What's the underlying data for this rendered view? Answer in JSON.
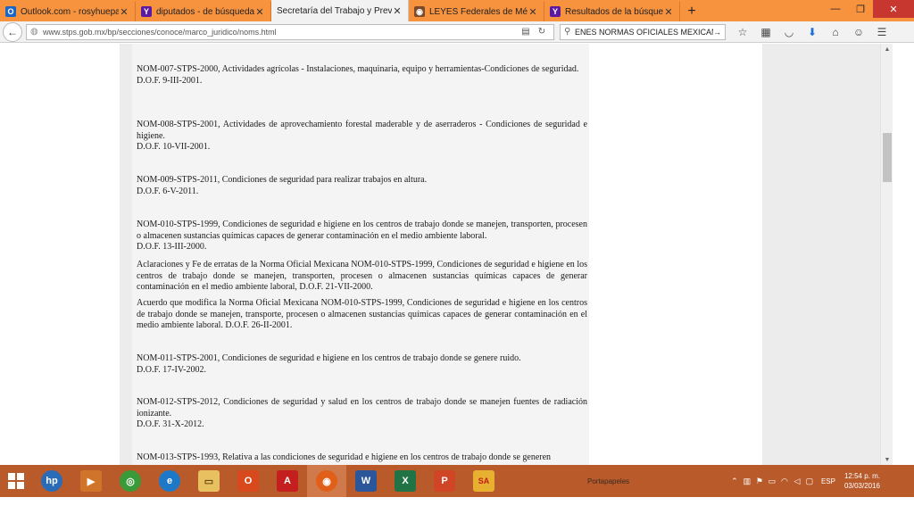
{
  "browser": {
    "tabs": [
      {
        "title": "Outlook.com - rosyhuepa...",
        "icon": "O",
        "icon_color": "#1a66c4",
        "close": "✕"
      },
      {
        "title": "diputados - de búsqueda",
        "icon": "Y",
        "icon_color": "#5b1aa0",
        "close": "✕"
      },
      {
        "title": "Secretaría del Trabajo y Previsi...",
        "icon": "",
        "icon_color": "",
        "close": "✕"
      },
      {
        "title": "LEYES Federales de México",
        "icon": "◉",
        "icon_color": "#7a4a2a",
        "close": "✕"
      },
      {
        "title": "Resultados de la búsqued...",
        "icon": "Y",
        "icon_color": "#5b1aa0",
        "close": "✕"
      }
    ],
    "new_tab": "+",
    "window_controls": {
      "minimize": "—",
      "restore": "❐",
      "close": "✕"
    },
    "url": "www.stps.gob.mx/bp/secciones/conoce/marco_juridico/noms.html",
    "search_value": "ENES NORMAS OFICIALES MEXICANAS"
  },
  "content": {
    "entries": [
      {
        "text": "NOM-007-STPS-2000, Actividades agrícolas - Instalaciones, maquinaria, equipo y herramientas-Condiciones de seguridad.",
        "dof": "D.O.F. 9-III-2001."
      },
      {
        "text": "NOM-008-STPS-2001, Actividades de aprovechamiento forestal maderable y de aserraderos - Condiciones de seguridad e higiene.",
        "dof": "D.O.F. 10-VII-2001."
      },
      {
        "text": "NOM-009-STPS-2011, Condiciones de seguridad para realizar trabajos en altura.",
        "dof": "D.O.F. 6-V-2011."
      },
      {
        "text": "NOM-010-STPS-1999, Condiciones de seguridad e higiene en los centros de trabajo donde se manejen, transporten, procesen o almacenen sustancias químicas capaces de generar contaminación en el medio ambiente laboral.",
        "dof": "D.O.F. 13-III-2000."
      },
      {
        "text": "Aclaraciones y Fe de erratas de la Norma Oficial Mexicana NOM-010-STPS-1999, Condiciones de seguridad e higiene en los centros de trabajo donde se manejen, transporten, procesen o almacenen sustancias químicas capaces de generar contaminación en el medio ambiente laboral, D.O.F. 21-VII-2000.",
        "dof": ""
      },
      {
        "text": "Acuerdo que modifica la Norma Oficial Mexicana NOM-010-STPS-1999, Condiciones de seguridad e higiene en los centros de trabajo donde se manejen, transporte, procesen o almacenen sustancias químicas capaces de generar contaminación en el medio ambiente laboral. D.O.F. 26-II-2001.",
        "dof": ""
      },
      {
        "text": "NOM-011-STPS-2001, Condiciones de seguridad e higiene en los centros de trabajo donde se genere ruido.",
        "dof": "D.O.F. 17-IV-2002."
      },
      {
        "text": "NOM-012-STPS-2012, Condiciones de seguridad y salud en los centros de trabajo donde se manejen fuentes de radiación ionizante.",
        "dof": "D.O.F. 31-X-2012."
      },
      {
        "text": "NOM-013-STPS-1993, Relativa a las condiciones de seguridad e higiene en los centros de trabajo donde se generen",
        "dof": ""
      }
    ]
  },
  "taskbar": {
    "apps": [
      {
        "name": "hp",
        "label": "hp",
        "color": "#2a6bb8"
      },
      {
        "name": "media",
        "label": "▶",
        "color": "#d0742a"
      },
      {
        "name": "chrome",
        "label": "◎",
        "color": "#3a9a3a"
      },
      {
        "name": "ie",
        "label": "e",
        "color": "#1e78c8"
      },
      {
        "name": "explorer",
        "label": "▭",
        "color": "#e8c060"
      },
      {
        "name": "office",
        "label": "O",
        "color": "#d84a1e"
      },
      {
        "name": "acrobat",
        "label": "A",
        "color": "#c41e1e"
      },
      {
        "name": "firefox",
        "label": "◉",
        "color": "#e0601a"
      },
      {
        "name": "word",
        "label": "W",
        "color": "#2b579a"
      },
      {
        "name": "excel",
        "label": "X",
        "color": "#217346"
      },
      {
        "name": "powerpoint",
        "label": "P",
        "color": "#d04526"
      },
      {
        "name": "sa",
        "label": "SA",
        "color": "#e8b030"
      }
    ],
    "clipboard_label": "Portapapeles",
    "language": "ESP",
    "time": "12:54 p. m.",
    "date": "03/03/2016"
  }
}
